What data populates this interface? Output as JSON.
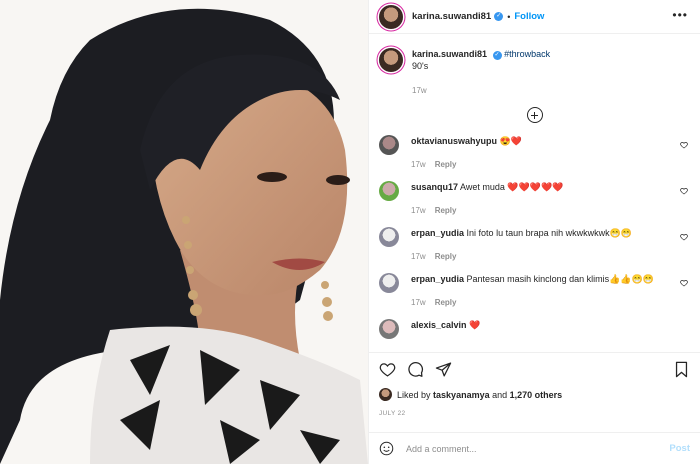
{
  "post": {
    "username": "karina.suwandi81",
    "follow_label": "Follow",
    "separator": "•",
    "more_glyph": "•••"
  },
  "caption": {
    "username": "karina.suwandi81",
    "hashtag": "#throwback",
    "text": "90's",
    "time": "17w"
  },
  "comments": [
    {
      "user": "oktavianuswahyupu",
      "text": "😍❤️",
      "time": "17w",
      "reply": "Reply"
    },
    {
      "user": "susanqu17",
      "text": "Awet muda ❤️❤️❤️❤️❤️",
      "time": "17w",
      "reply": "Reply"
    },
    {
      "user": "erpan_yudia",
      "text": "Ini foto lu taun brapa nih wkwkwkwk😁😁",
      "time": "17w",
      "reply": "Reply"
    },
    {
      "user": "erpan_yudia",
      "text": "Pantesan masih kinclong dan klimis👍👍😁😁",
      "time": "17w",
      "reply": "Reply"
    },
    {
      "user": "alexis_calvin",
      "text": "❤️",
      "time": "",
      "reply": ""
    }
  ],
  "likes": {
    "prefix": "Liked by",
    "user": "taskyanamya",
    "connector": "and",
    "others": "1,270 others"
  },
  "date": "JULY 22",
  "add_comment": {
    "placeholder": "Add a comment...",
    "post_label": "Post"
  },
  "icons": {
    "verified": "verified-badge-icon",
    "heart": "heart-icon",
    "comment": "comment-bubble-icon",
    "share": "paper-plane-icon",
    "bookmark": "bookmark-icon",
    "emoji": "smiley-icon",
    "load_more": "plus-circle-icon"
  },
  "colors": {
    "link_blue": "#0095f6",
    "verified_blue": "#3897f0",
    "muted": "#8e8e8e",
    "post_disabled": "#b2dffc",
    "heart_red": "#ed4956"
  }
}
